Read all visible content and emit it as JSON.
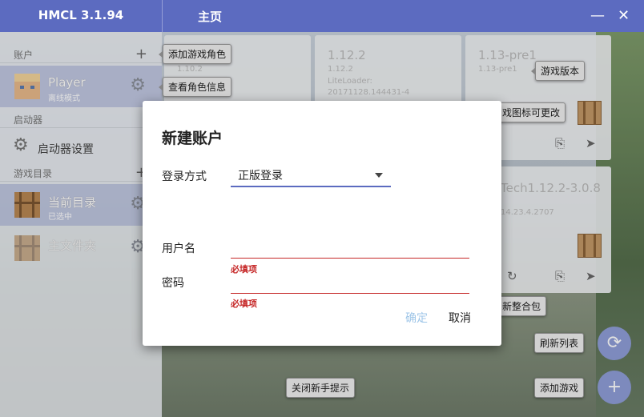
{
  "app": {
    "title": "HMCL 3.1.94",
    "page_title": "主页"
  },
  "window_controls": {
    "minimize_icon": "minimize-icon",
    "close_icon": "close-icon"
  },
  "sidebar": {
    "accounts_header": "账户",
    "account": {
      "name": "Player",
      "mode": "离线模式"
    },
    "launcher_header": "启动器",
    "launcher_settings": "启动器设置",
    "game_dir_header": "游戏目录",
    "dirs": [
      {
        "name": "当前目录",
        "sub": "已选中"
      },
      {
        "name": "主文件夹",
        "sub": ""
      }
    ]
  },
  "cards": [
    {
      "version": "",
      "sub1": "1.10.2",
      "sub2": ""
    },
    {
      "version": "1.12.2",
      "sub1": "1.12.2",
      "sub2": "LiteLoader: 20171128.144431-4"
    },
    {
      "version": "1.13-pre1",
      "sub1": "1.13-pre1",
      "sub2": ""
    },
    {
      "version": "Tech1.12.2-3.0.8",
      "sub1": "14.23.4.2707",
      "sub2": ""
    }
  ],
  "tooltips": {
    "add_character": "添加游戏角色",
    "view_character": "查看角色信息",
    "game_version": "游戏版本",
    "icon_changeable": "戏图标可更改",
    "update_modpack": "新整合包",
    "refresh_list": "刷新列表",
    "add_game": "添加游戏",
    "close_tips": "关闭新手提示"
  },
  "dialog": {
    "title": "新建账户",
    "login_method_label": "登录方式",
    "login_method_value": "正版登录",
    "username_label": "用户名",
    "password_label": "密码",
    "required_error": "必填项",
    "confirm": "确定",
    "cancel": "取消"
  },
  "colors": {
    "accent": "#5c6bc0",
    "error": "#c62828",
    "confirm_disabled": "#9fc6e8"
  }
}
